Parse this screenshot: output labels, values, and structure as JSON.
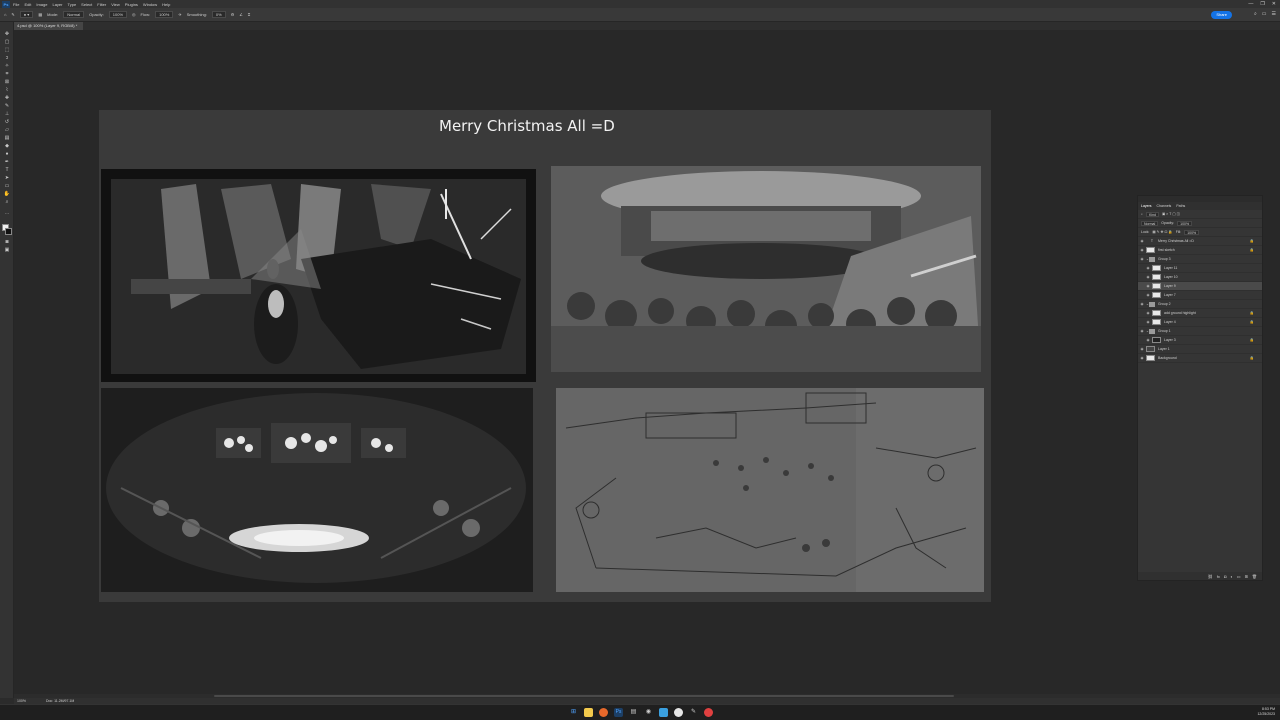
{
  "app": {
    "icon_label": "Ps",
    "menu": [
      "File",
      "Edit",
      "Image",
      "Layer",
      "Type",
      "Select",
      "Filter",
      "View",
      "Plugins",
      "Window",
      "Help"
    ],
    "window_controls": [
      "—",
      "❐",
      "✕"
    ]
  },
  "options_bar": {
    "mode_label": "Mode:",
    "mode_value": "Normal",
    "opacity_label": "Opacity:",
    "opacity_value": "100%",
    "flow_label": "Flow:",
    "flow_value": "100%",
    "smoothing_label": "Smoothing:",
    "smoothing_value": "0%",
    "share_label": "Share"
  },
  "document_tab": {
    "title": "4.psd @ 100% (Layer 9, RGB/8) *"
  },
  "canvas": {
    "title": "Merry Christmas All =D",
    "panels": [
      "thumbnail-sketch-1",
      "thumbnail-sketch-2",
      "thumbnail-sketch-3",
      "thumbnail-sketch-4"
    ]
  },
  "layers_panel": {
    "tabs": [
      "Layers",
      "Channels",
      "Paths"
    ],
    "filter_label": "Kind",
    "blend_mode": "Normal",
    "opacity_label": "Opacity:",
    "opacity_value": "100%",
    "lock_label": "Lock:",
    "fill_label": "Fill:",
    "fill_value": "100%",
    "layers": [
      {
        "name": "Merry Christmas All =D",
        "type": "text",
        "locked": true
      },
      {
        "name": "first sketch",
        "type": "layer",
        "locked": true
      },
      {
        "name": "Group 3",
        "type": "group",
        "locked": false
      },
      {
        "name": "Layer 11",
        "type": "layer",
        "locked": false
      },
      {
        "name": "Layer 10",
        "type": "layer",
        "locked": false
      },
      {
        "name": "Layer 9",
        "type": "layer",
        "locked": false,
        "selected": true
      },
      {
        "name": "Layer 7",
        "type": "layer",
        "locked": false
      },
      {
        "name": "Group 2",
        "type": "group",
        "locked": false
      },
      {
        "name": "add ground highlight",
        "type": "layer",
        "locked": true
      },
      {
        "name": "Layer 4",
        "type": "layer",
        "locked": true
      },
      {
        "name": "Group 1",
        "type": "group",
        "locked": false
      },
      {
        "name": "Layer 3",
        "type": "layer",
        "locked": true
      },
      {
        "name": "Layer 1",
        "type": "layer",
        "locked": false
      },
      {
        "name": "Background",
        "type": "layer",
        "locked": true
      }
    ]
  },
  "status_bar": {
    "zoom": "100%",
    "doc_info": "Doc: 11.2M/97.1M"
  },
  "taskbar": {
    "time": "8:53 PM",
    "date": "12/25/2023"
  },
  "colors": {
    "accent": "#1473e6",
    "canvas_bg": "#282828",
    "panel_bg": "#353535"
  }
}
